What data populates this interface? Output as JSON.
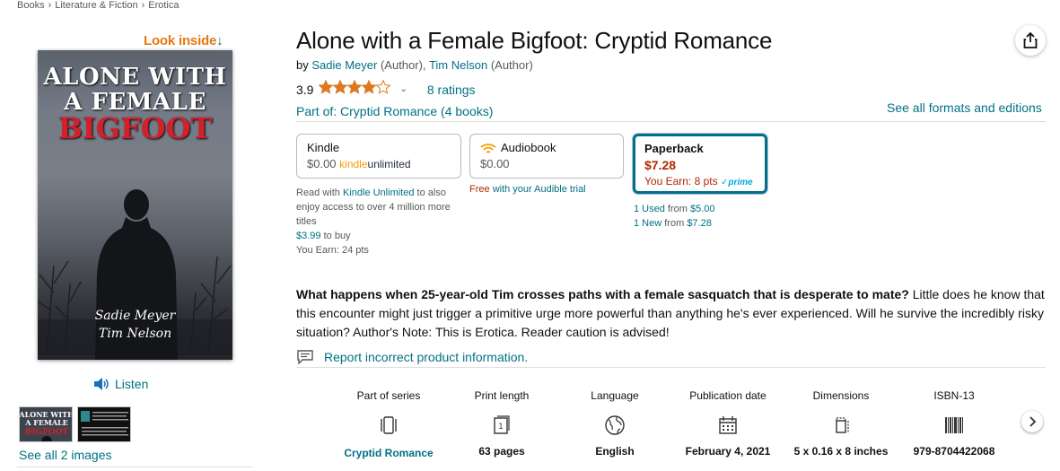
{
  "breadcrumb": [
    "Books",
    "Literature & Fiction",
    "Erotica"
  ],
  "breadcrumb_sep": "›",
  "left": {
    "look_inside": "Look inside",
    "look_inside_arrow": "↓",
    "cover": {
      "title_line1": "ALONE WITH",
      "title_line2": "A FEMALE",
      "title_line3": "BIGFOOT",
      "author1": "Sadie Meyer",
      "author2": "Tim Nelson"
    },
    "listen": "Listen",
    "see_all_images": "See all 2 images"
  },
  "product": {
    "title": "Alone with a Female Bigfoot: Cryptid Romance",
    "by": "by",
    "author1": "Sadie Meyer",
    "author1_role": "(Author),",
    "author2": "Tim Nelson",
    "author2_role": "(Author)",
    "rating_value": "3.9",
    "stars": 3.9,
    "ratings_link": "8 ratings",
    "series_link": "Part of: Cryptid Romance (4 books)",
    "formats_link": "See all formats and editions"
  },
  "formats": {
    "kindle": {
      "name": "Kindle",
      "price": "$0.00",
      "ku_kindle": "kindle",
      "ku_unlimited": "unlimited"
    },
    "audiobook": {
      "name": "Audiobook",
      "price": "$0.00"
    },
    "paperback": {
      "name": "Paperback",
      "price": "$7.28",
      "earn": "You Earn: 8 pts",
      "prime": "prime"
    }
  },
  "kindle_note": {
    "prefix": "Read with",
    "link": "Kindle Unlimited",
    "suffix": "to also enjoy access to over 4 million more titles",
    "buy_price": "$3.99",
    "buy_suffix": "to buy",
    "earn": "You Earn: 24 pts"
  },
  "audible_note": {
    "free": "Free",
    "link": "with your Audible trial"
  },
  "paperback_offers": {
    "used_link": "1 Used",
    "used_from": "from",
    "used_price": "$5.00",
    "new_link": "1 New",
    "new_from": "from",
    "new_price": "$7.28"
  },
  "description": {
    "bold": "What happens when 25-year-old Tim crosses paths with a female sasquatch that is desperate to mate?",
    "rest": " Little does he know that this encounter might just trigger a primitive urge more powerful than anything he's ever experienced. Will he survive the incredibly risky situation? Author's Note: This is Erotica. Reader caution is advised!"
  },
  "report_link": "Report incorrect product information.",
  "specs": [
    {
      "label": "Part of series",
      "value": "Cryptid Romance",
      "icon": "book-series-icon"
    },
    {
      "label": "Print length",
      "value": "63 pages",
      "icon": "page-count-icon"
    },
    {
      "label": "Language",
      "value": "English",
      "icon": "globe-icon"
    },
    {
      "label": "Publication date",
      "value": "February 4, 2021",
      "icon": "calendar-icon"
    },
    {
      "label": "Dimensions",
      "value": "5 x 0.16 x 8 inches",
      "icon": "dimensions-icon"
    },
    {
      "label": "ISBN-13",
      "value": "979-8704422068",
      "icon": "barcode-icon"
    }
  ],
  "colors": {
    "link": "#007185",
    "star": "#de7921",
    "price_red": "#b12704",
    "look_inside": "#e47911"
  }
}
